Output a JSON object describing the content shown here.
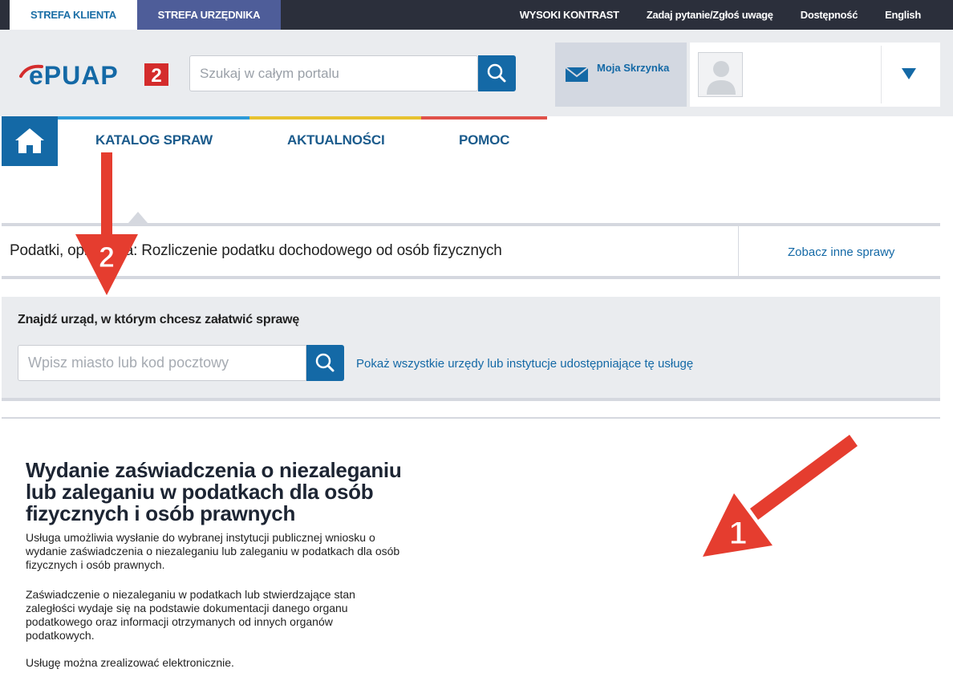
{
  "topbar": {
    "tab_client": "STREFA KLIENTA",
    "tab_official": "STREFA URZĘDNIKA",
    "high_contrast": "WYSOKI KONTRAST",
    "ask": "Zadaj pytanie/Zgłoś uwagę",
    "accessibility": "Dostępność",
    "english": "English"
  },
  "header": {
    "logo_text": "ePUAP",
    "logo_badge": "2",
    "search_placeholder": "Szukaj w całym portalu",
    "mailbox_label": "Moja Skrzynka"
  },
  "nav": {
    "items": [
      "KATALOG SPRAW",
      "AKTUALNOŚCI",
      "POMOC"
    ],
    "colors": [
      "#2d9ad8",
      "#e7c230",
      "#e0514a"
    ]
  },
  "breadcrumb": {
    "text": "Podatki, opłaty, cła: Rozliczenie podatku dochodowego od osób fizycznych",
    "other_link": "Zobacz inne sprawy"
  },
  "finder": {
    "title": "Znajdź urząd, w którym chcesz załatwić sprawę",
    "input_placeholder": "Wpisz miasto lub kod pocztowy",
    "show_all_link": "Pokaż wszystkie urzędy lub instytucje udostępniające tę usługę"
  },
  "service": {
    "title": "Wydanie zaświadczenia o niezaleganiu lub zaleganiu w podatkach dla osób fizycznych i osób prawnych",
    "paragraphs": [
      "Usługa umożliwia wysłanie do wybranej instytucji publicznej wniosku o wydanie zaświadczenia o niezaleganiu lub zaleganiu w podatkach dla osób fizycznych i osób prawnych.",
      "Zaświadczenie o niezaleganiu w podatkach lub stwierdzające stan zaległości wydaje się na podstawie dokumentacji danego organu podatkowego oraz informacji otrzymanych od innych organów podatkowych.",
      "Usługę można zrealizować elektronicznie."
    ]
  },
  "annotations": {
    "arrow1_label": "1",
    "arrow2_label": "2",
    "color": "#e53d2f"
  },
  "icons": {
    "search": "search-icon",
    "mail": "mail-icon",
    "home": "home-icon",
    "avatar": "user-avatar-icon",
    "dropdown": "chevron-down-icon"
  }
}
